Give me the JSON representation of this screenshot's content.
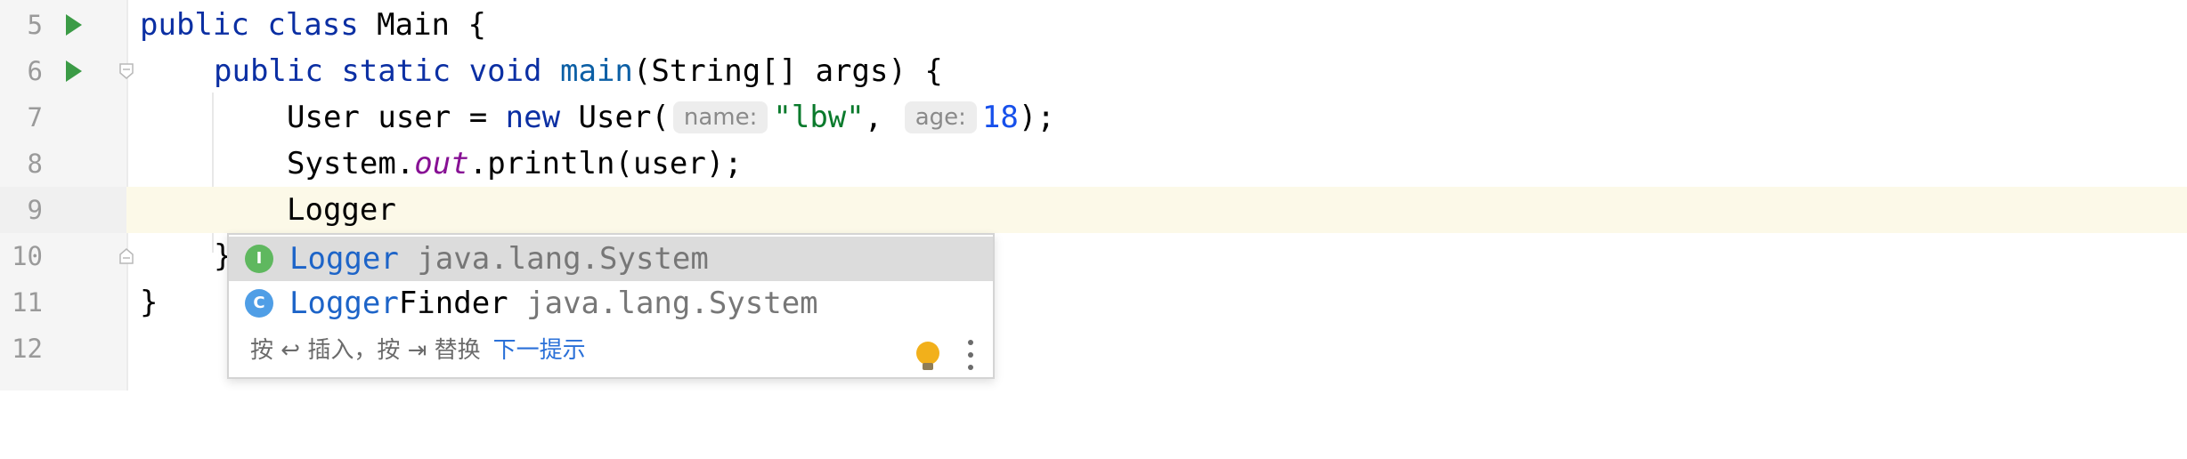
{
  "editor": {
    "lines": [
      {
        "num": "5",
        "run": true,
        "tokens": [
          "public",
          "class",
          "Main {"
        ]
      },
      {
        "num": "6",
        "run": true
      },
      {
        "num": "7"
      },
      {
        "num": "8"
      },
      {
        "num": "9",
        "current": true
      },
      {
        "num": "10"
      },
      {
        "num": "11"
      },
      {
        "num": "12"
      }
    ],
    "line5": {
      "kw1": "public",
      "kw2": "class",
      "rest": " Main {"
    },
    "line6": {
      "kw1": "public",
      "kw2": "static",
      "kw3": "void",
      "fn": "main",
      "rest": "(String[] args) {"
    },
    "line7": {
      "p1": "User user = ",
      "kw": "new",
      "p2": " User(",
      "hint1": "name:",
      "str": "\"lbw\"",
      "comma": ", ",
      "hint2": "age:",
      "num": "18",
      "end": ");"
    },
    "line8": {
      "p1": "System.",
      "field": "out",
      "p2": ".println(user);"
    },
    "line9": {
      "text": "Logger"
    },
    "line10": {
      "text": "}"
    },
    "line11": {
      "text": "}"
    }
  },
  "completion": {
    "items": [
      {
        "icon": "interface-icon",
        "icon_letter": "I",
        "match": "Logger",
        "rest": "",
        "pkg": "java.lang.System"
      },
      {
        "icon": "class-icon",
        "icon_letter": "C",
        "match": "Logger",
        "rest": "Finder",
        "pkg": "java.lang.System"
      }
    ],
    "footer_hint": "按 ↩ 插入，按 ⇥ 替换",
    "footer_link": "下一提示"
  },
  "colors": {
    "keyword": "#0b2fa3",
    "run_icon": "#3b9b46",
    "current_line": "#fcf9e8"
  }
}
